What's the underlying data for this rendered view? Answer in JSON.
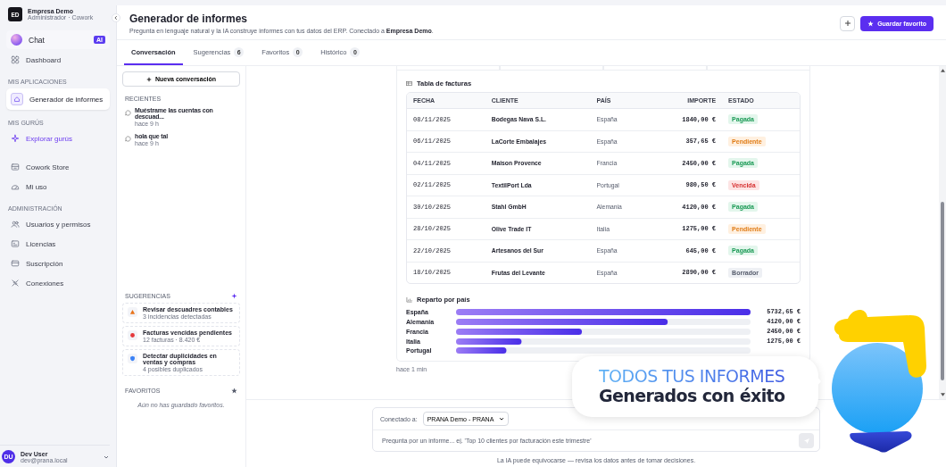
{
  "sidebar": {
    "org": {
      "initials": "ED",
      "name": "Empresa Demo",
      "role": "Administrador · Cowork"
    },
    "items": [
      {
        "kind": "chat",
        "label": "Chat",
        "badge": "AI",
        "selected": false
      },
      {
        "kind": "item",
        "label": "Dashboard",
        "selected": false
      }
    ],
    "sections": [
      {
        "title": "MIS APLICACIONES",
        "items": [
          {
            "kind": "app",
            "label": "Generador de informes",
            "selected": true
          }
        ]
      },
      {
        "title": "MIS GURÚS",
        "items": [
          {
            "kind": "link",
            "label": "Explorar gurús",
            "selected": false
          },
          {
            "kind": "item",
            "label": "Cowork Store",
            "selected": false
          },
          {
            "kind": "item",
            "label": "Mi uso",
            "selected": false
          }
        ]
      },
      {
        "title": "ADMINISTRACIÓN",
        "items": [
          {
            "kind": "item",
            "label": "Usuarios y permisos",
            "selected": false
          },
          {
            "kind": "item",
            "label": "Licencias",
            "selected": false
          },
          {
            "kind": "item",
            "label": "Suscripción",
            "selected": false
          },
          {
            "kind": "item",
            "label": "Conexiones",
            "selected": false
          }
        ]
      }
    ],
    "user": {
      "initials": "DU",
      "name": "Dev User",
      "email": "dev@prana.local"
    }
  },
  "header": {
    "title": "Generador de informes",
    "subtitle": "Pregunta en lenguaje natural y la IA construye informes con tus datos del ERP. Conectado a **Empresa Demo**.",
    "primary_button": "Guardar favorito"
  },
  "tabs": [
    {
      "label": "Conversación",
      "selected": true
    },
    {
      "label": "Sugerencias",
      "count": "6",
      "selected": false
    },
    {
      "label": "Favoritos",
      "count": "0",
      "selected": false
    },
    {
      "label": "Histórico",
      "count": "0",
      "selected": false
    }
  ],
  "left_pane": {
    "new_button": "Nueva conversación",
    "recents_title": "RECIENTES",
    "recents": [
      {
        "title": "Muéstrame las cuentas con descuad...",
        "time": "hace 9 h"
      },
      {
        "title": "hola que tal",
        "time": "hace 9 h"
      }
    ],
    "suggestions_title": "SUGERENCIAS",
    "suggestions": [
      {
        "title": "Revisar descuadres contables",
        "detail": "3 incidencias detectadas",
        "color": "#e8731a"
      },
      {
        "title": "Facturas vencidas pendientes",
        "detail": "12 facturas · 8.420 €",
        "color": "#e5383b"
      },
      {
        "title": "Detectar duplicidades en ventas y compras",
        "detail": "4 posibles duplicados",
        "color": "#3b82f6"
      }
    ],
    "favorites_title": "FAVORITOS",
    "favorites_empty": "Aún no has guardado favoritos."
  },
  "report": {
    "table_title": "Tabla de facturas",
    "columns": [
      "FECHA",
      "CLIENTE",
      "PAÍS",
      "IMPORTE",
      "ESTADO"
    ],
    "rows": [
      {
        "date": "08/11/2025",
        "client": "Bodegas Nava S.L.",
        "country": "España",
        "amount": "1840,00 €",
        "status": "Pagada",
        "kind": "success"
      },
      {
        "date": "06/11/2025",
        "client": "LaCorte Embalajes",
        "country": "España",
        "amount": "357,65 €",
        "status": "Pendiente",
        "kind": "warning"
      },
      {
        "date": "04/11/2025",
        "client": "Maison Provence",
        "country": "Francia",
        "amount": "2450,00 €",
        "status": "Pagada",
        "kind": "success"
      },
      {
        "date": "02/11/2025",
        "client": "TextilPort Lda",
        "country": "Portugal",
        "amount": "980,50 €",
        "status": "Vencida",
        "kind": "danger"
      },
      {
        "date": "30/10/2025",
        "client": "Stahl GmbH",
        "country": "Alemania",
        "amount": "4120,00 €",
        "status": "Pagada",
        "kind": "success"
      },
      {
        "date": "28/10/2025",
        "client": "Olive Trade IT",
        "country": "Italia",
        "amount": "1275,00 €",
        "status": "Pendiente",
        "kind": "warning"
      },
      {
        "date": "22/10/2025",
        "client": "Artesanos del Sur",
        "country": "España",
        "amount": "645,00 €",
        "status": "Pagada",
        "kind": "success"
      },
      {
        "date": "18/10/2025",
        "client": "Frutas del Levante",
        "country": "España",
        "amount": "2890,00 €",
        "status": "Borrador",
        "kind": "neutral"
      }
    ],
    "chart_title": "Reparto por país",
    "chart_data": {
      "type": "bar",
      "orientation": "horizontal",
      "categories": [
        "España",
        "Alemania",
        "Francia",
        "Italia",
        "Portugal"
      ],
      "values": [
        5732.65,
        4120,
        2450,
        1275,
        980.5
      ],
      "value_labels": [
        "5732,65 €",
        "4120,00 €",
        "2450,00 €",
        "1275,00 €",
        null
      ]
    },
    "time": "hace 1 min"
  },
  "composer": {
    "connection_label": "Conectado a:",
    "connection_value": "PRANA Demo - PRANA",
    "placeholder": "Pregunta por un informe... ej. 'Top 10 clientes por facturación este trimestre'"
  },
  "disclaimer": "La IA puede equivocarse — revisa los datos antes de tomar decisiones.",
  "promo": {
    "line_1": "TODOS TUS INFORMES",
    "line_2": "Generados con éxito"
  }
}
